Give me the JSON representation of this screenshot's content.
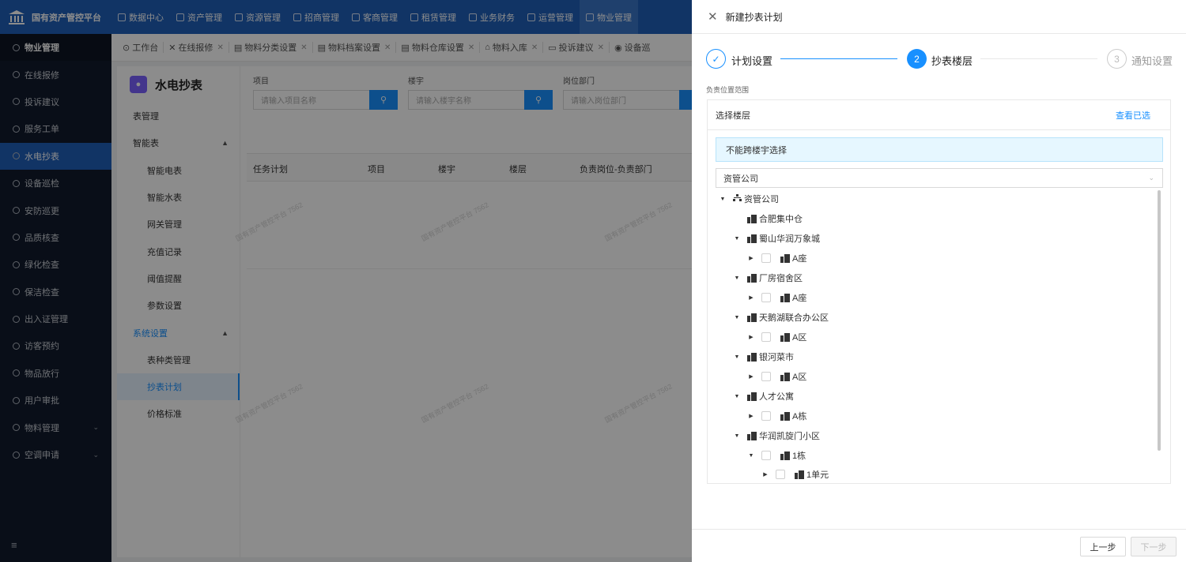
{
  "topbar": {
    "brand": "国有资产管控平台",
    "nav": [
      {
        "label": "数据中心",
        "icon": "chart-icon"
      },
      {
        "label": "资产管理",
        "icon": "box-icon"
      },
      {
        "label": "资源管理",
        "icon": "building-icon"
      },
      {
        "label": "招商管理",
        "icon": "tag-icon"
      },
      {
        "label": "客商管理",
        "icon": "users-icon"
      },
      {
        "label": "租赁管理",
        "icon": "home-icon"
      },
      {
        "label": "业务财务",
        "icon": "coin-icon"
      },
      {
        "label": "运营管理",
        "icon": "grid-icon"
      },
      {
        "label": "物业管理",
        "icon": "house-icon"
      }
    ]
  },
  "sidebar": {
    "header": "物业管理",
    "items": [
      {
        "label": "在线报修"
      },
      {
        "label": "投诉建议"
      },
      {
        "label": "服务工单"
      },
      {
        "label": "水电抄表"
      },
      {
        "label": "设备巡检"
      },
      {
        "label": "安防巡更"
      },
      {
        "label": "品质核查"
      },
      {
        "label": "绿化检查"
      },
      {
        "label": "保洁检查"
      },
      {
        "label": "出入证管理"
      },
      {
        "label": "访客预约"
      },
      {
        "label": "物品放行"
      },
      {
        "label": "用户审批"
      },
      {
        "label": "物料管理"
      },
      {
        "label": "空调申请"
      }
    ],
    "collapse_icon": "≡"
  },
  "tabs": [
    {
      "label": "工作台"
    },
    {
      "label": "在线报修"
    },
    {
      "label": "物料分类设置"
    },
    {
      "label": "物料档案设置"
    },
    {
      "label": "物料仓库设置"
    },
    {
      "label": "物料入库"
    },
    {
      "label": "投诉建议"
    },
    {
      "label": "设备巡"
    }
  ],
  "submenu": {
    "title": "水电抄表",
    "items": [
      {
        "label": "表管理"
      },
      {
        "label": "智能表"
      },
      {
        "label": "智能电表"
      },
      {
        "label": "智能水表"
      },
      {
        "label": "网关管理"
      },
      {
        "label": "充值记录"
      },
      {
        "label": "阈值提醒"
      },
      {
        "label": "参数设置"
      },
      {
        "label": "系统设置"
      },
      {
        "label": "表种类管理"
      },
      {
        "label": "抄表计划"
      },
      {
        "label": "价格标准"
      }
    ]
  },
  "filters": {
    "project_label": "项目",
    "project_placeholder": "请输入项目名称",
    "building_label": "楼宇",
    "building_placeholder": "请输入楼宇名称",
    "dept_label": "岗位部门",
    "dept_placeholder": "请输入岗位部门"
  },
  "table": {
    "columns": [
      "任务计划",
      "项目",
      "楼宇",
      "楼层",
      "负责岗位-负责部门"
    ]
  },
  "watermark": "国有资产管控平台 7562",
  "drawer": {
    "title": "新建抄表计划",
    "steps": [
      {
        "num": "✓",
        "label": "计划设置",
        "state": "done"
      },
      {
        "num": "2",
        "label": "抄表楼层",
        "state": "active"
      },
      {
        "num": "3",
        "label": "通知设置",
        "state": "pending"
      }
    ],
    "section_label": "负责位置范围",
    "panel_title": "选择楼层",
    "view_selected": "查看已选",
    "notice": "不能跨楼宇选择",
    "select_value": "资管公司",
    "tree": [
      {
        "label": "资管公司",
        "type": "org"
      },
      {
        "label": "合肥集中仓"
      },
      {
        "label": "蜀山华润万象城"
      },
      {
        "label": "A座"
      },
      {
        "label": "厂房宿舍区"
      },
      {
        "label": "A座"
      },
      {
        "label": "天鹅湖联合办公区"
      },
      {
        "label": "A区"
      },
      {
        "label": "银河菜市"
      },
      {
        "label": "A区"
      },
      {
        "label": "人才公寓"
      },
      {
        "label": "A栋"
      },
      {
        "label": "华润凯旋门小区"
      },
      {
        "label": "1栋"
      },
      {
        "label": "1单元"
      }
    ],
    "prev_button": "上一步",
    "next_button": "下一步"
  },
  "colors": {
    "primary": "#1890ff",
    "topbar": "#1f5fb9",
    "sidebar": "#111b2c"
  }
}
